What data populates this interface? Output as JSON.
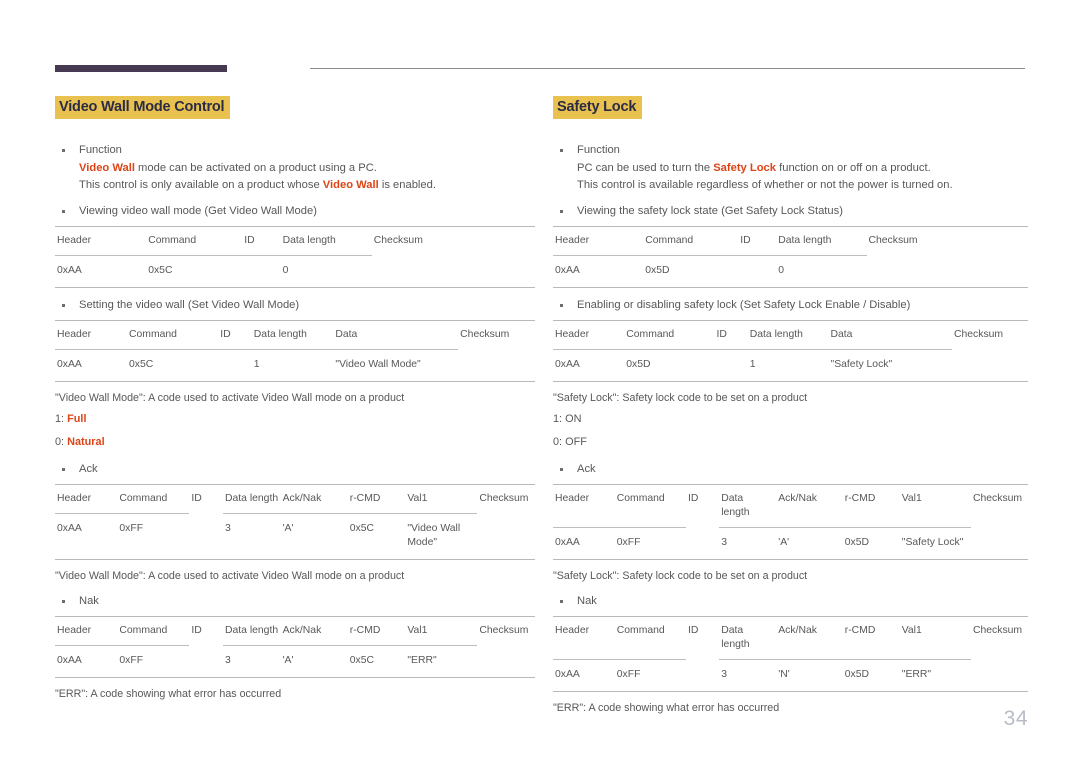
{
  "document": {
    "page_number": "34",
    "accent_rule_color": "#453a52",
    "heading_highlight_color": "#e8c14e",
    "emphasis_color": "#dd4417"
  },
  "left": {
    "title": "Video Wall Mode Control",
    "function": {
      "label": "Function",
      "line1_pre": "",
      "line1_em": "Video Wall",
      "line1_post": " mode can be activated on a product using a PC.",
      "line2_pre": "This control is only available on a product whose ",
      "line2_em": "Video Wall",
      "line2_post": " is enabled."
    },
    "get": {
      "bullet": "Viewing video wall mode (Get Video Wall Mode)",
      "headers": [
        "Header",
        "Command",
        "ID",
        "Data length",
        "Checksum"
      ],
      "row": [
        "0xAA",
        "0x5C",
        "",
        "0",
        ""
      ]
    },
    "set": {
      "bullet": "Setting the video wall (Set Video Wall Mode)",
      "headers": [
        "Header",
        "Command",
        "ID",
        "Data length",
        "Data",
        "Checksum"
      ],
      "row": [
        "0xAA",
        "0x5C",
        "",
        "1",
        "\"Video Wall Mode\"",
        ""
      ],
      "note": "\"Video Wall Mode\": A code used to activate Video Wall mode on a product",
      "options": [
        {
          "key": "1: ",
          "value": "Full"
        },
        {
          "key": "0: ",
          "value": "Natural"
        }
      ]
    },
    "ack": {
      "bullet": "Ack",
      "headers": [
        "Header",
        "Command",
        "ID",
        "Data length",
        "Ack/Nak",
        "r-CMD",
        "Val1",
        "Checksum"
      ],
      "row": [
        "0xAA",
        "0xFF",
        "",
        "3",
        "'A'",
        "0x5C",
        "\"Video Wall Mode\"",
        ""
      ],
      "note": "\"Video Wall Mode\": A code used to activate Video Wall mode on a product"
    },
    "nak": {
      "bullet": "Nak",
      "headers": [
        "Header",
        "Command",
        "ID",
        "Data length",
        "Ack/Nak",
        "r-CMD",
        "Val1",
        "Checksum"
      ],
      "row": [
        "0xAA",
        "0xFF",
        "",
        "3",
        "'A'",
        "0x5C",
        "\"ERR\"",
        ""
      ],
      "note": "\"ERR\": A code showing what error has occurred"
    }
  },
  "right": {
    "title": "Safety Lock",
    "function": {
      "label": "Function",
      "line1_pre": "PC can be used to turn the ",
      "line1_em": "Safety Lock",
      "line1_post": " function on or off on a product.",
      "line2": "This control is available regardless of whether or not the power is turned on."
    },
    "get": {
      "bullet": "Viewing the safety lock state (Get Safety Lock Status)",
      "headers": [
        "Header",
        "Command",
        "ID",
        "Data length",
        "Checksum"
      ],
      "row": [
        "0xAA",
        "0x5D",
        "",
        "0",
        ""
      ]
    },
    "set": {
      "bullet": "Enabling or disabling safety lock (Set Safety Lock Enable / Disable)",
      "headers": [
        "Header",
        "Command",
        "ID",
        "Data length",
        "Data",
        "Checksum"
      ],
      "row": [
        "0xAA",
        "0x5D",
        "",
        "1",
        "\"Safety Lock\"",
        ""
      ],
      "note": "\"Safety Lock\": Safety lock code to be set on a product",
      "options": [
        {
          "key": "1: ",
          "value": "ON"
        },
        {
          "key": "0: ",
          "value": "OFF"
        }
      ]
    },
    "ack": {
      "bullet": "Ack",
      "headers": [
        "Header",
        "Command",
        "ID",
        "Data length",
        "Ack/Nak",
        "r-CMD",
        "Val1",
        "Checksum"
      ],
      "row": [
        "0xAA",
        "0xFF",
        "",
        "3",
        "'A'",
        "0x5D",
        "\"Safety Lock\"",
        ""
      ],
      "note": "\"Safety Lock\": Safety lock code to be set on a product"
    },
    "nak": {
      "bullet": "Nak",
      "headers": [
        "Header",
        "Command",
        "ID",
        "Data length",
        "Ack/Nak",
        "r-CMD",
        "Val1",
        "Checksum"
      ],
      "row": [
        "0xAA",
        "0xFF",
        "",
        "3",
        "'N'",
        "0x5D",
        "\"ERR\"",
        ""
      ],
      "note": "\"ERR\": A code showing what error has occurred"
    }
  }
}
